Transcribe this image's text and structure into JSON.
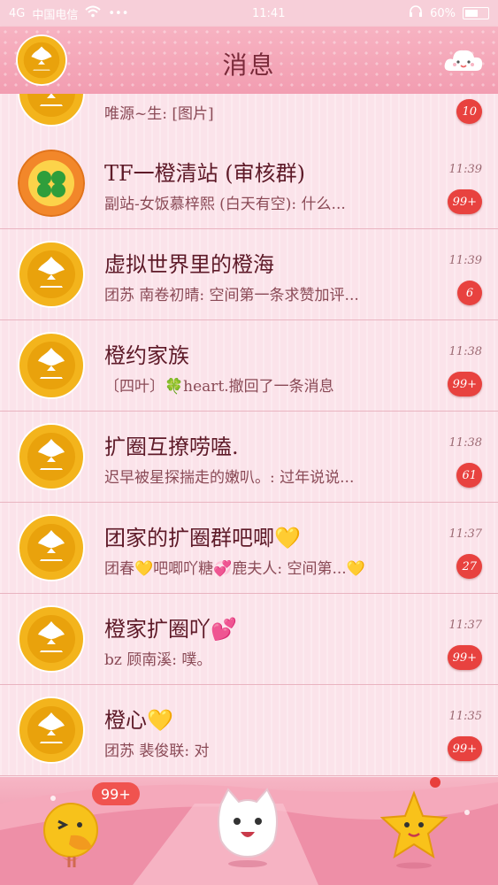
{
  "status": {
    "carrier": "中国电信",
    "network": "4G",
    "time": "11:41",
    "battery": "60%"
  },
  "header": {
    "title": "消息"
  },
  "chats": [
    {
      "name": "",
      "preview": "唯源~生: [图片]",
      "time": "",
      "badge": "10",
      "avatar": "orange-gold"
    },
    {
      "name": "TF一橙清站 (审核群)",
      "preview": "副站-女饭慕梓熙 (白天有空): 什么...",
      "time": "11:39",
      "badge": "99+",
      "avatar": "orange-clover"
    },
    {
      "name": "虚拟世界里的橙海",
      "preview": "团苏 南卷初晴: 空间第一条求赞加评...",
      "time": "11:39",
      "badge": "6",
      "avatar": "tfboys"
    },
    {
      "name": "橙约家族",
      "preview": "〔四叶〕🍀heart.撤回了一条消息",
      "time": "11:38",
      "badge": "99+",
      "avatar": "tfboys"
    },
    {
      "name": "扩圈互撩唠嗑.",
      "preview": "迟早被星探揣走的嫩叭。: 过年说说...",
      "time": "11:38",
      "badge": "61",
      "avatar": "tfboys"
    },
    {
      "name": "团家的扩圈群吧唧💛",
      "preview": "团春💛吧唧吖糖💞鹿夫人: 空间第...💛",
      "time": "11:37",
      "badge": "27",
      "avatar": "tfboys"
    },
    {
      "name": "橙家扩圈吖💕",
      "preview": "bz 顾南溪: 噗。",
      "time": "11:37",
      "badge": "99+",
      "avatar": "tfboys"
    },
    {
      "name": "橙心💛",
      "preview": "团苏 裴俊联: 对",
      "time": "11:35",
      "badge": "99+",
      "avatar": "tfboys"
    }
  ],
  "bottom_nav": {
    "messages_badge": "99+",
    "tabs": [
      "messages",
      "contacts",
      "discover"
    ]
  },
  "colors": {
    "header": "#f29db1",
    "row_bg": "#fbe3ea",
    "badge": "#e8423f",
    "name_text": "#5e1a28"
  }
}
